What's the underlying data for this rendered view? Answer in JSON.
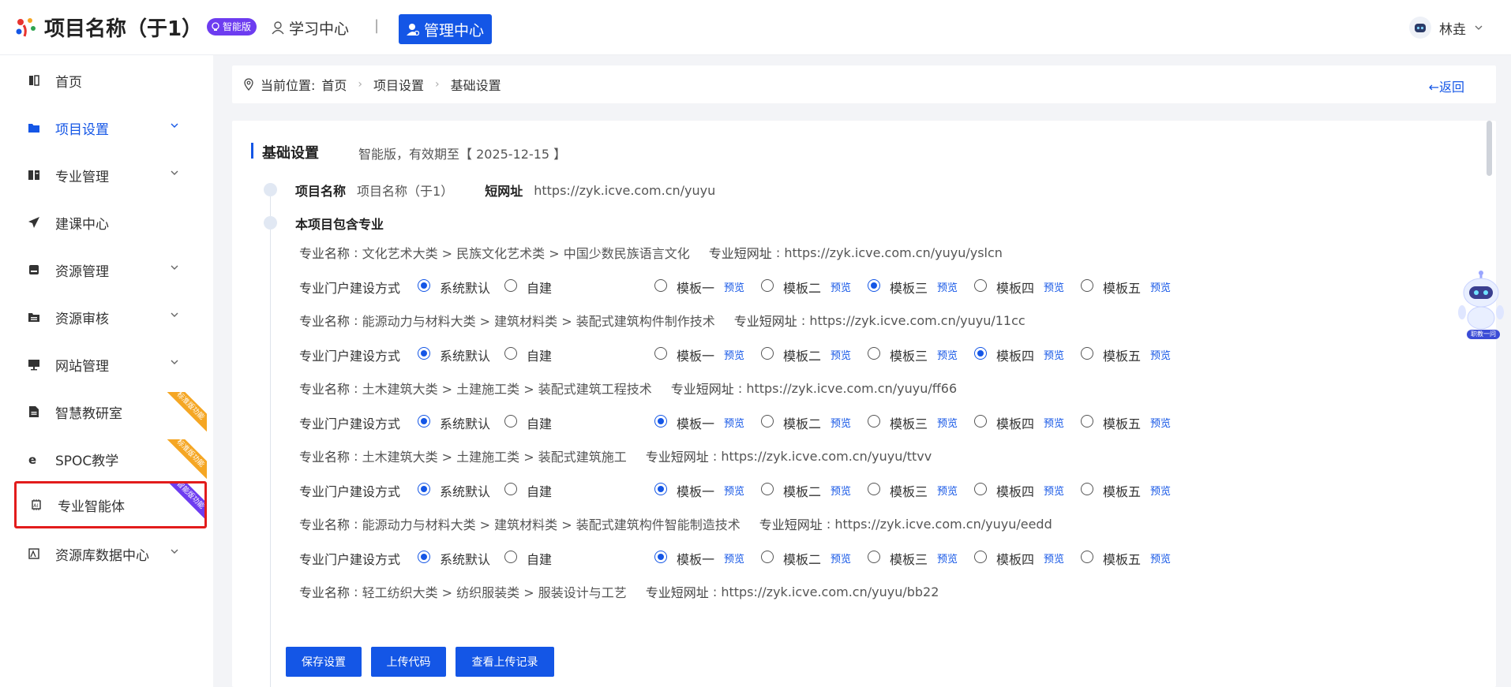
{
  "header": {
    "app_title": "项目名称（于1）",
    "edition_badge": "智能版",
    "nav_learning": "学习中心",
    "nav_separator": "|",
    "nav_manage": "管理中心",
    "user_name": "林垚"
  },
  "sidebar": {
    "items": [
      {
        "label": "首页",
        "icon": "home-icon",
        "has_chevron": false
      },
      {
        "label": "项目设置",
        "icon": "folder-icon",
        "has_chevron": true,
        "active": true
      },
      {
        "label": "专业管理",
        "icon": "book-icon",
        "has_chevron": true
      },
      {
        "label": "建课中心",
        "icon": "send-icon",
        "has_chevron": false
      },
      {
        "label": "资源管理",
        "icon": "box-icon",
        "has_chevron": true
      },
      {
        "label": "资源审核",
        "icon": "doc-icon",
        "has_chevron": true
      },
      {
        "label": "网站管理",
        "icon": "monitor-icon",
        "has_chevron": true
      },
      {
        "label": "智慧教研室",
        "icon": "file-icon",
        "ribbon": "标准版功能"
      },
      {
        "label": "SPOC教学",
        "icon": "ie-icon",
        "ribbon": "标准版功能"
      },
      {
        "label": "专业智能体",
        "icon": "ai-chip-icon",
        "ribbon": "智能版功能",
        "highlighted": true
      },
      {
        "label": "资源库数据中心",
        "icon": "data-icon",
        "has_chevron": true
      }
    ]
  },
  "breadcrumb": {
    "prefix": "当前位置:",
    "items": [
      "首页",
      "项目设置",
      "基础设置"
    ],
    "back": "返回"
  },
  "panel": {
    "title": "基础设置",
    "note": "智能版，有效期至【 2025-12-15 】",
    "project_name_label": "项目名称",
    "project_name_value": "项目名称（于1）",
    "short_url_label": "短网址",
    "short_url_value": "https://zyk.icve.com.cn/yuyu",
    "majors_heading": "本项目包含专业",
    "major_name_key": "专业名称",
    "major_url_key": "专业短网址",
    "portal_label": "专业门户建设方式",
    "build_options": [
      "系统默认",
      "自建"
    ],
    "templates": [
      "模板一",
      "模板二",
      "模板三",
      "模板四",
      "模板五"
    ],
    "preview_label": "预览",
    "majors": [
      {
        "name": "文化艺术大类 > 民族文化艺术类 > 中国少数民族语言文化",
        "url": "https://zyk.icve.com.cn/yuyu/yslcn",
        "build": 0,
        "template": 2
      },
      {
        "name": "能源动力与材料大类 > 建筑材料类 > 装配式建筑构件制作技术",
        "url": "https://zyk.icve.com.cn/yuyu/11cc",
        "build": 0,
        "template": 3
      },
      {
        "name": "土木建筑大类 > 土建施工类 > 装配式建筑工程技术",
        "url": "https://zyk.icve.com.cn/yuyu/ff66",
        "build": 0,
        "template": 0
      },
      {
        "name": "土木建筑大类 > 土建施工类 > 装配式建筑施工",
        "url": "https://zyk.icve.com.cn/yuyu/ttvv",
        "build": 0,
        "template": 0
      },
      {
        "name": "能源动力与材料大类 > 建筑材料类 > 装配式建筑构件智能制造技术",
        "url": "https://zyk.icve.com.cn/yuyu/eedd",
        "build": 0,
        "template": 0
      },
      {
        "name": "轻工纺织大类 > 纺织服装类 > 服装设计与工艺",
        "url": "https://zyk.icve.com.cn/yuyu/bb22"
      }
    ],
    "buttons": [
      "保存设置",
      "上传代码",
      "查看上传记录"
    ]
  },
  "assistant": {
    "label": "职教一问"
  },
  "colors": {
    "primary": "#1456e6",
    "badge_purple": "#6d3cf0",
    "ribbon_orange": "#f5a623",
    "highlight_red": "#e21c1c"
  }
}
